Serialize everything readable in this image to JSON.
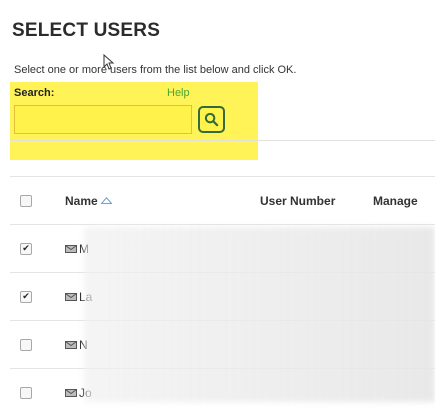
{
  "page": {
    "title": "SELECT USERS",
    "instructions": "Select one or more users from the list below and click OK."
  },
  "search": {
    "label": "Search:",
    "help_label": "Help",
    "value": "",
    "placeholder": "",
    "button_icon": "search-icon",
    "highlight_color": "#fff24a"
  },
  "table": {
    "columns": {
      "select": "",
      "name": "Name",
      "user_number": "User Number",
      "manager": "Manage"
    },
    "sort": {
      "column": "Name",
      "icon": "sort-ascending-icon"
    },
    "rows": [
      {
        "checked": true,
        "name": "M",
        "user_number": "",
        "manager": ""
      },
      {
        "checked": true,
        "name": "La",
        "user_number": "",
        "manager": ""
      },
      {
        "checked": false,
        "name": "N",
        "user_number": "",
        "manager": ""
      },
      {
        "checked": false,
        "name": "Jo",
        "user_number": "",
        "manager": ""
      }
    ]
  },
  "check_mark": "✔"
}
